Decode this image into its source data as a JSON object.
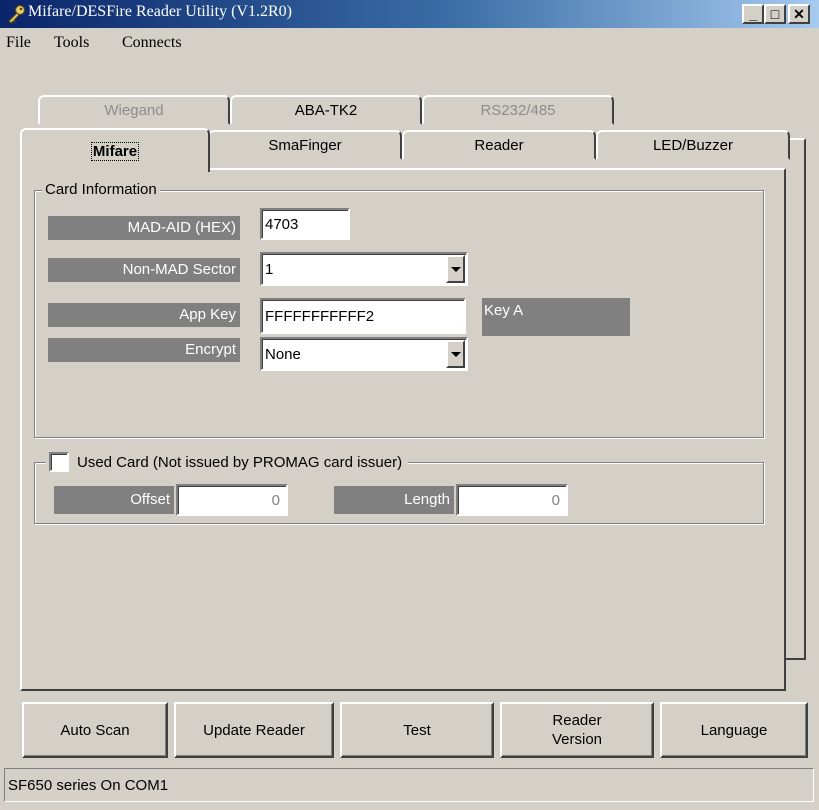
{
  "window": {
    "title": "Mifare/DESFire Reader Utility (V1.2R0)",
    "controls": {
      "minimize": "_",
      "maximize": "□",
      "close": "✕"
    }
  },
  "menu": {
    "items": [
      "File",
      "Tools",
      "Connects"
    ]
  },
  "tabs": {
    "row1": [
      "Wiegand",
      "ABA-TK2",
      "RS232/485"
    ],
    "row2": [
      "Mifare",
      "SmaFinger",
      "Reader",
      "LED/Buzzer"
    ],
    "active": "Mifare"
  },
  "card_info": {
    "legend": "Card Information",
    "mad_aid_label": "MAD-AID (HEX)",
    "mad_aid_value": "4703",
    "non_mad_label": "Non-MAD Sector",
    "non_mad_value": "1",
    "app_key_label": "App Key",
    "app_key_value": "FFFFFFFFFFF2",
    "key_type": "Key A",
    "encrypt_label": "Encrypt",
    "encrypt_value": "None"
  },
  "used_card": {
    "label": "Used Card (Not issued by PROMAG card issuer)",
    "checked": false,
    "offset_label": "Offset",
    "offset_value": "0",
    "length_label": "Length",
    "length_value": "0"
  },
  "buttons": {
    "auto_scan": "Auto Scan",
    "update_reader": "Update Reader",
    "test": "Test",
    "reader_version_line1": "Reader",
    "reader_version_line2": "Version",
    "language": "Language"
  },
  "status": {
    "text": "SF650 series On COM1"
  }
}
